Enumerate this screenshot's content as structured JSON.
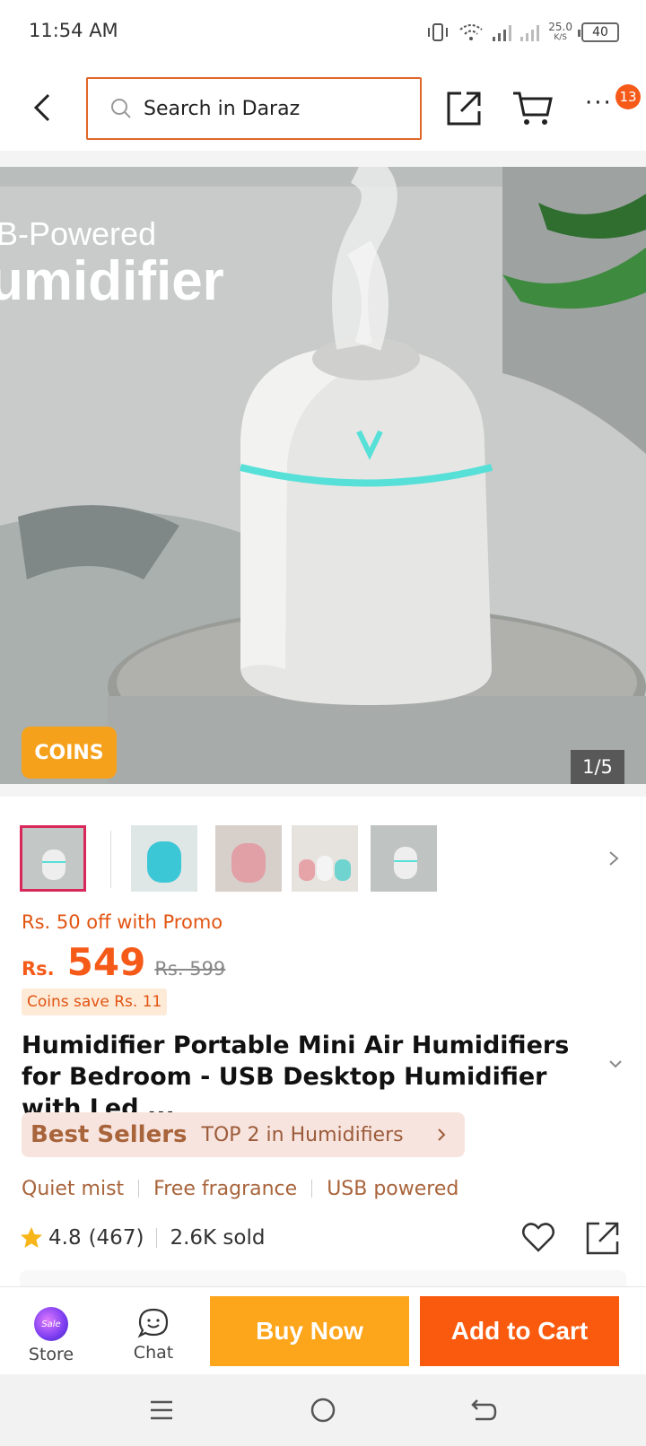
{
  "status_bar": {
    "time": "11:54 AM",
    "speed_value": "25.0",
    "speed_unit": "K/S",
    "battery": "40"
  },
  "header": {
    "search_placeholder": "Search in Daraz",
    "notification_count": "13",
    "accent_color": "#e0662a"
  },
  "image": {
    "overlay_line1": "B-Powered",
    "overlay_line2": "umidifier",
    "coins_badge": "COINS",
    "counter": "1/5"
  },
  "thumbnails": [
    {
      "name": "thumb-white",
      "selected": true
    },
    {
      "name": "thumb-blue",
      "selected": false
    },
    {
      "name": "thumb-pink",
      "selected": false
    },
    {
      "name": "thumb-three",
      "selected": false
    },
    {
      "name": "thumb-white-2",
      "selected": false
    }
  ],
  "pricing": {
    "promo": "Rs. 50 off with Promo",
    "currency": "Rs.",
    "price": "549",
    "original_price": "Rs. 599",
    "coins_save": "Coins save Rs. 11"
  },
  "product": {
    "title": "Humidifier Portable Mini Air Humidifiers for Bedroom - USB Desktop Humidifier with Led ...",
    "bestseller_label": "Best Sellers",
    "bestseller_rank": "TOP 2 in Humidifiers",
    "features": [
      "Quiet mist",
      "Free fragrance",
      "USB powered"
    ],
    "rating": "4.8",
    "rating_count": "(467)",
    "sold": "2.6K sold"
  },
  "bottom_bar": {
    "store_label": "Store",
    "chat_label": "Chat",
    "buy_now": "Buy Now",
    "add_to_cart": "Add to Cart",
    "buy_color": "#fda51b",
    "cart_color": "#f95a0e"
  }
}
